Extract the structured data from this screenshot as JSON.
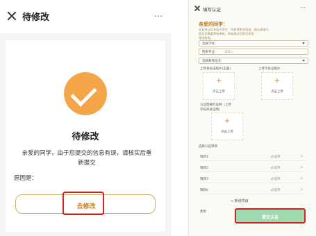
{
  "left": {
    "header": {
      "title": "待修改",
      "more": "⋯"
    },
    "status_heading": "待修改",
    "message_line1": "亲爱的同学，由于您提交的信息有误，请核实后重",
    "message_line2": "新提交",
    "reason_label": "原因是：",
    "edit_button": "去修改",
    "icons": {
      "close": "close-icon",
      "status": "check-circle-icon"
    },
    "colors": {
      "accent": "#f4a547",
      "highlight": "#d32020"
    }
  },
  "right": {
    "header": {
      "title": "填写认证",
      "more": "⋯"
    },
    "greeting": "亲爱的同学：",
    "intro_line1": "欢迎你认证本站大学生，为获得更多权益，请认真填写，",
    "intro_line2": "提交后需要等待审核，审核通过后即可享受",
    "intro_line3": "相关服务。",
    "selects": [
      {
        "label": "选择学校：",
        "value": ""
      },
      {
        "label": "院系专业：",
        "value": "请填入"
      },
      {
        "label": "选择教育层次：",
        "value": ""
      }
    ],
    "upload_labels": {
      "front": "上传身份证照片(正面)",
      "back": "上传学生证照片"
    },
    "upload_action": "点击上传",
    "enrollment_label_line1": "认证需要的证明（上传",
    "enrollment_label_line2": "学校开具证明）",
    "items_section": "选择认证项目",
    "items": [
      {
        "name": "项目1",
        "req": "必选项"
      },
      {
        "name": "项目2",
        "req": "必选项"
      },
      {
        "name": "项目3",
        "req": "必选项"
      },
      {
        "name": "项目4",
        "req": "必选项"
      }
    ],
    "add_item": "+ 新增项目",
    "fee_label": "费用",
    "submit_button": "提交认证",
    "colors": {
      "submit": "#9fd9b0",
      "highlight": "#d32020"
    }
  }
}
